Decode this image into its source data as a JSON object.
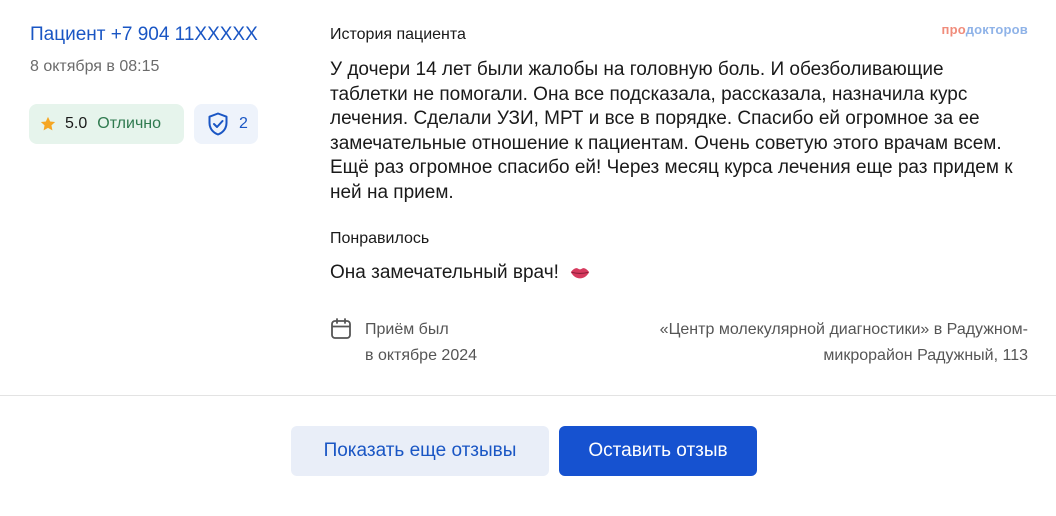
{
  "review": {
    "author": "Пациент +7 904 11XXXXX",
    "date": "8 октября в 08:15",
    "rating": {
      "score": "5.0",
      "word": "Отлично"
    },
    "verifications": "2",
    "story_title": "История пациента",
    "story_text": "У дочери 14 лет были жалобы на головную боль. И обезболивающие таблетки не помогали. Она все подсказала, рассказала, назначила курс лечения. Сделали УЗИ, МРТ и все в порядке. Спасибо ей огромное за ее замечательные отношение к пациентам. Очень советую этого врачам всем. Ещё раз огромное спасибо ей! Через месяц курса лечения еще раз придем к ней на прием.",
    "liked_title": "Понравилось",
    "liked_text": "Она замечательный врач!",
    "visit_line1": "Приём был",
    "visit_line2": "в октябре 2024",
    "clinic_line1": "«Центр молекулярной диагностики» в Радужном-",
    "clinic_line2": "микрорайон Радужный, 113"
  },
  "logo": {
    "part1": "про",
    "part2": "докторов"
  },
  "buttons": {
    "more": "Показать еще отзывы",
    "leave": "Оставить отзыв"
  },
  "colors": {
    "link": "#1a56c4",
    "rating_bg": "#e6f4ec",
    "rating_text": "#2f7a4f",
    "primary_button": "#1652d0",
    "secondary_button": "#e9eef8"
  }
}
